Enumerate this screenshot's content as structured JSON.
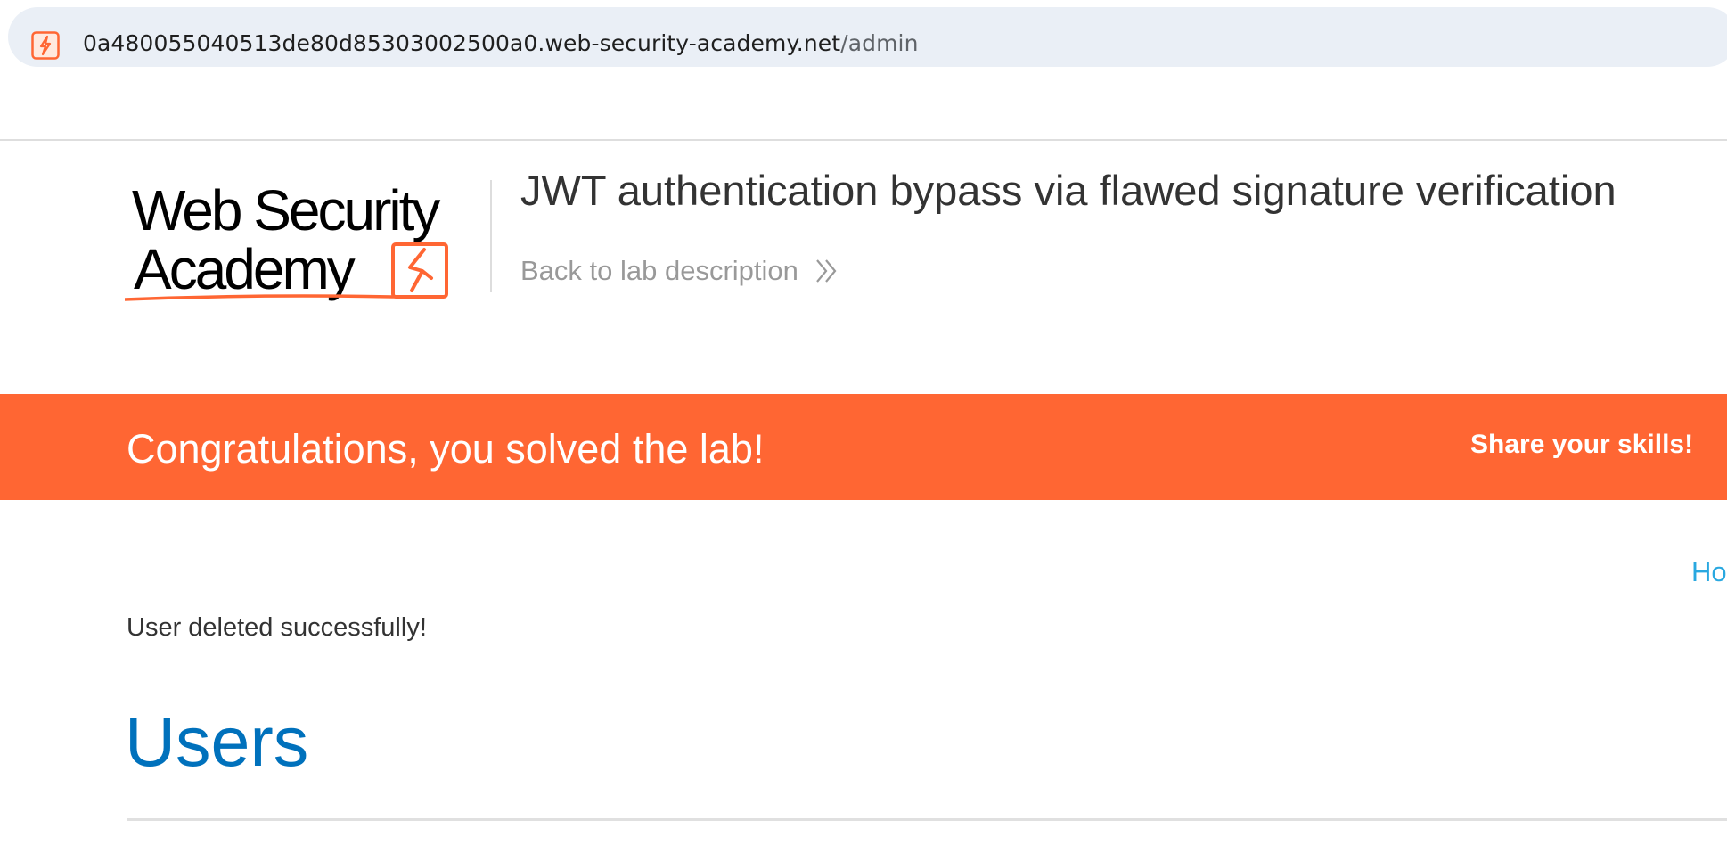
{
  "browser": {
    "url_host": "0a480055040513de80d85303002500a0.web-security-academy.net",
    "url_path": "/admin",
    "site_icon": "lightning-bolt-icon"
  },
  "header": {
    "logo_line1": "Web Security",
    "logo_line2": "Academy",
    "lab_title": "JWT authentication bypass via flawed signature verification",
    "back_link": "Back to lab description"
  },
  "banner": {
    "message": "Congratulations, you solved the lab!",
    "share": "Share your skills!",
    "color": "#ff6633"
  },
  "nav": {
    "home_partial": "Ho"
  },
  "main": {
    "status": "User deleted successfully!",
    "heading": "Users"
  },
  "colors": {
    "accent_orange": "#ff6633",
    "heading_blue": "#0071bc",
    "link_blue": "#29a8e0"
  }
}
